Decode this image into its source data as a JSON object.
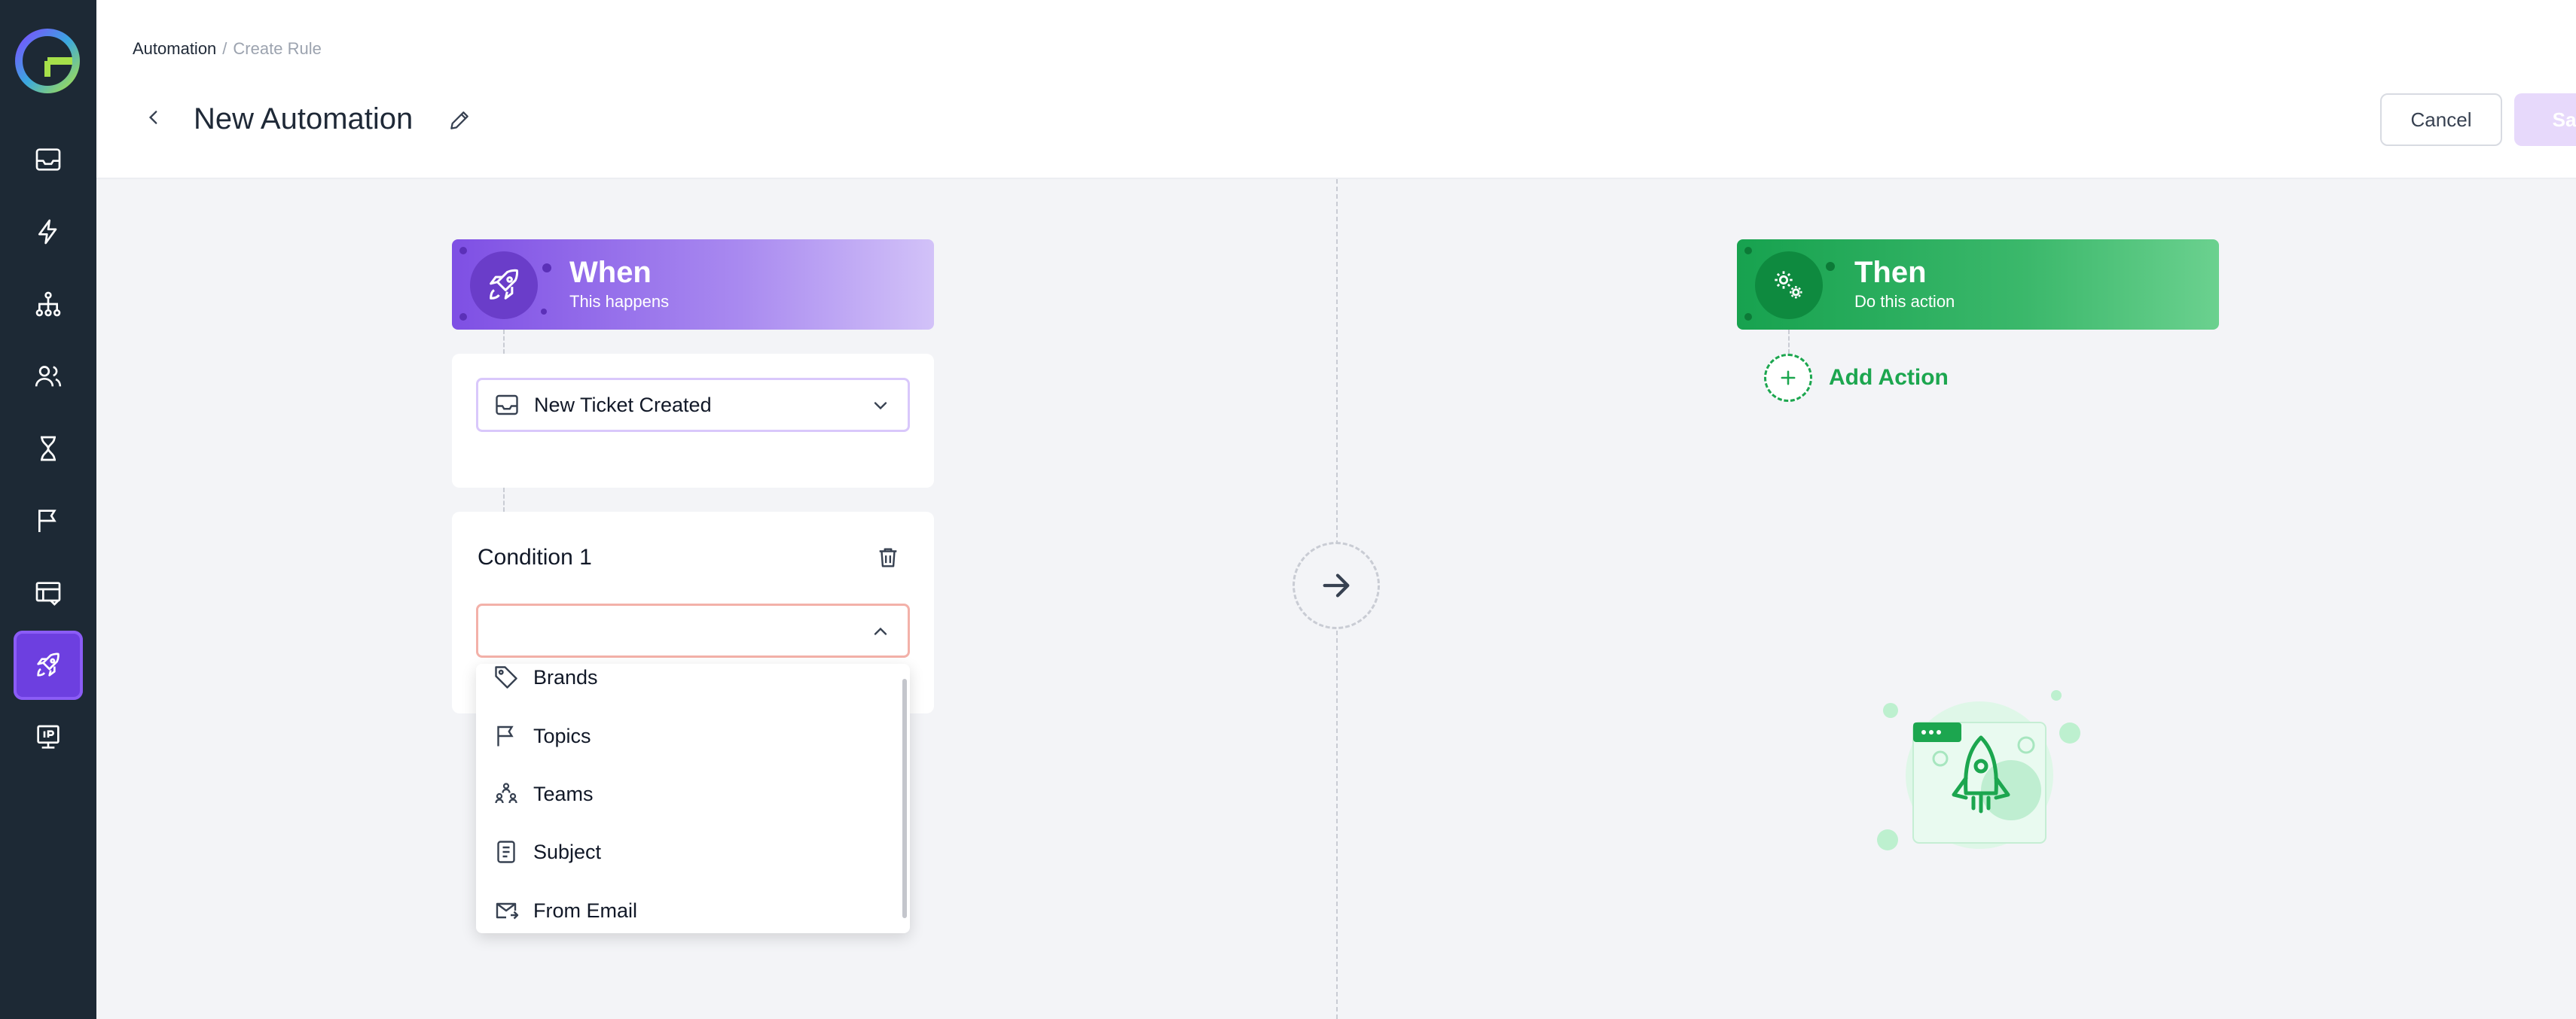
{
  "app": {
    "logo_letter": "G"
  },
  "sidebar": {
    "items": [
      {
        "icon": "inbox-icon",
        "active": false
      },
      {
        "icon": "lightning-icon",
        "active": false
      },
      {
        "icon": "hierarchy-icon",
        "active": false
      },
      {
        "icon": "users-icon",
        "active": false
      },
      {
        "icon": "hourglass-icon",
        "active": false
      },
      {
        "icon": "flag-icon",
        "active": false
      },
      {
        "icon": "table-arrow-icon",
        "active": false
      },
      {
        "icon": "rocket-icon",
        "active": true
      },
      {
        "icon": "ip-monitor-icon",
        "active": false
      }
    ]
  },
  "header": {
    "breadcrumb_root": "Automation",
    "breadcrumb_sep": "/",
    "breadcrumb_current": "Create Rule",
    "title": "New Automation",
    "cancel_label": "Cancel",
    "save_label": "Save"
  },
  "when": {
    "title": "When",
    "subtitle": "This happens",
    "trigger_value": "New Ticket Created"
  },
  "condition": {
    "title": "Condition 1",
    "value": "",
    "options": [
      {
        "label": "Brands",
        "icon": "tag-icon"
      },
      {
        "label": "Topics",
        "icon": "flag-icon"
      },
      {
        "label": "Teams",
        "icon": "teams-icon"
      },
      {
        "label": "Subject",
        "icon": "subject-icon"
      },
      {
        "label": "From Email",
        "icon": "email-forward-icon"
      }
    ]
  },
  "then": {
    "title": "Then",
    "subtitle": "Do this action",
    "add_action_label": "Add Action"
  },
  "colors": {
    "sidebar_bg": "#1d2935",
    "accent_purple": "#6d3fe0",
    "accent_green": "#1ca64f",
    "save_disabled": "#e7d9fb"
  }
}
